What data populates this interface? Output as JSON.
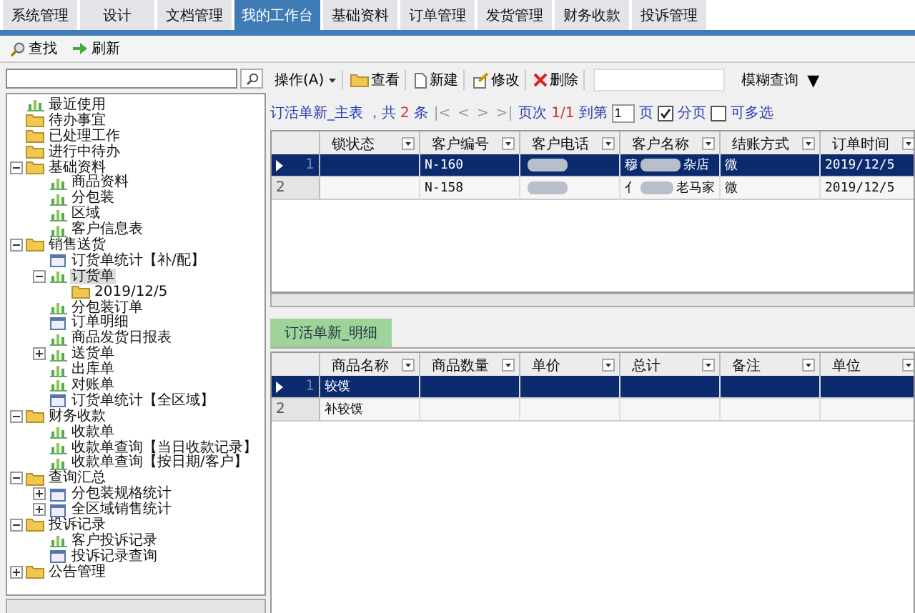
{
  "tabs": [
    {
      "label": "系统管理",
      "selected": false
    },
    {
      "label": "设计",
      "selected": false
    },
    {
      "label": "文档管理",
      "selected": false
    },
    {
      "label": "我的工作台",
      "selected": true
    },
    {
      "label": "基础资料",
      "selected": false
    },
    {
      "label": "订单管理",
      "selected": false
    },
    {
      "label": "发货管理",
      "selected": false
    },
    {
      "label": "财务收款",
      "selected": false
    },
    {
      "label": "投诉管理",
      "selected": false
    }
  ],
  "toolbar": [
    {
      "label": "查找",
      "kind": "search"
    },
    {
      "label": "刷新",
      "kind": "refresh"
    }
  ],
  "tree": [
    {
      "label": "最近使用",
      "kind": "chart",
      "selected": false
    },
    {
      "label": "待办事宜",
      "kind": "folder",
      "selected": false
    },
    {
      "label": "已处理工作",
      "kind": "folder",
      "selected": false
    },
    {
      "label": "进行中待办",
      "kind": "folder",
      "selected": false
    },
    {
      "label": "基础资料",
      "kind": "folder",
      "selected": false,
      "expanded": true,
      "children": [
        {
          "label": "商品资料",
          "kind": "chart",
          "selected": false
        },
        {
          "label": "分包装",
          "kind": "chart",
          "selected": false
        },
        {
          "label": "区域",
          "kind": "chart",
          "selected": false
        },
        {
          "label": "客户信息表",
          "kind": "chart",
          "selected": false
        }
      ]
    },
    {
      "label": "销售送货",
      "kind": "folder",
      "selected": false,
      "expanded": true,
      "children": [
        {
          "label": "订货单统计【补/配】",
          "kind": "form",
          "selected": false
        },
        {
          "label": "订货单",
          "kind": "chart",
          "selected": true,
          "expanded": true,
          "children": [
            {
              "label": "2019/12/5",
              "kind": "folder",
              "selected": false
            }
          ]
        },
        {
          "label": "分包装订单",
          "kind": "chart",
          "selected": false
        },
        {
          "label": "订单明细",
          "kind": "form",
          "selected": false
        },
        {
          "label": "商品发货日报表",
          "kind": "chart",
          "selected": false
        },
        {
          "label": "送货单",
          "kind": "chart",
          "selected": false,
          "expanded": false
        },
        {
          "label": "出库单",
          "kind": "chart",
          "selected": false
        },
        {
          "label": "对账单",
          "kind": "chart",
          "selected": false
        },
        {
          "label": "订货单统计【全区域】",
          "kind": "form",
          "selected": false
        }
      ]
    },
    {
      "label": "财务收款",
      "kind": "folder",
      "selected": false,
      "expanded": true,
      "children": [
        {
          "label": "收款单",
          "kind": "chart",
          "selected": false
        },
        {
          "label": "收款单查询【当日收款记录】",
          "kind": "chart",
          "selected": false
        },
        {
          "label": "收款单查询【按日期/客户】",
          "kind": "chart",
          "selected": false
        }
      ]
    },
    {
      "label": "查询汇总",
      "kind": "folder",
      "selected": false,
      "expanded": true,
      "children": [
        {
          "label": "分包装规格统计",
          "kind": "form",
          "selected": false,
          "expanded": false
        },
        {
          "label": "全区域销售统计",
          "kind": "form",
          "selected": false,
          "expanded": false
        }
      ]
    },
    {
      "label": "投诉记录",
      "kind": "folder",
      "selected": false,
      "expanded": true,
      "children": [
        {
          "label": "客户投诉记录",
          "kind": "chart",
          "selected": false
        },
        {
          "label": "投诉记录查询",
          "kind": "form",
          "selected": false
        }
      ]
    },
    {
      "label": "公告管理",
      "kind": "folder",
      "selected": false,
      "expanded": false
    }
  ],
  "grid_toolbar": {
    "menu": "操作(A)",
    "buttons": [
      {
        "label": "查看",
        "kind": "folder"
      },
      {
        "label": "新建",
        "kind": "page"
      },
      {
        "label": "修改",
        "kind": "edit"
      },
      {
        "label": "删除",
        "kind": "delete"
      }
    ],
    "filter": "模糊查询",
    "filter_arrow": "▼"
  },
  "master": {
    "title": "订活单新_主表",
    "total_prefix": "，共",
    "total": "2",
    "total_unit": "条",
    "nav": [
      "|<",
      "<",
      ">",
      ">|"
    ],
    "page_label": "页次",
    "page": "1/1",
    "goto_label": "到第",
    "goto_value": "1",
    "goto_unit": "页",
    "options": [
      {
        "label": "分页",
        "checked": true
      },
      {
        "label": "可多选",
        "checked": false
      }
    ],
    "columns": [
      "锁状态",
      "客户编号",
      "客户电话",
      "客户名称",
      "结账方式",
      "订单时间"
    ],
    "rows": [
      {
        "number": "1",
        "selected": true,
        "cells": [
          {
            "kind": "text"
          },
          {
            "kind": "text",
            "text": "N-160"
          },
          {
            "kind": "redacted"
          },
          {
            "kind": "redacted",
            "parts": [
              "穆",
              "杂店"
            ]
          },
          {
            "kind": "text",
            "text": "微"
          },
          {
            "kind": "text",
            "text": "2019/12/5"
          }
        ]
      },
      {
        "number": "2",
        "selected": false,
        "cells": [
          {
            "kind": "text"
          },
          {
            "kind": "text",
            "text": "N-158"
          },
          {
            "kind": "redacted"
          },
          {
            "kind": "redacted",
            "parts": [
              "亻",
              "老马家"
            ]
          },
          {
            "kind": "text",
            "text": "微"
          },
          {
            "kind": "text",
            "text": "2019/12/5"
          }
        ]
      }
    ]
  },
  "detail": {
    "tab": "订活单新_明细",
    "columns": [
      "商品名称",
      "商品数量",
      "单价",
      "总计",
      "备注",
      "单位"
    ],
    "rows": [
      {
        "number": "1",
        "selected": true,
        "cells": [
          "较馍"
        ]
      },
      {
        "number": "2",
        "selected": false,
        "cells": [
          "补较馍"
        ]
      }
    ]
  }
}
